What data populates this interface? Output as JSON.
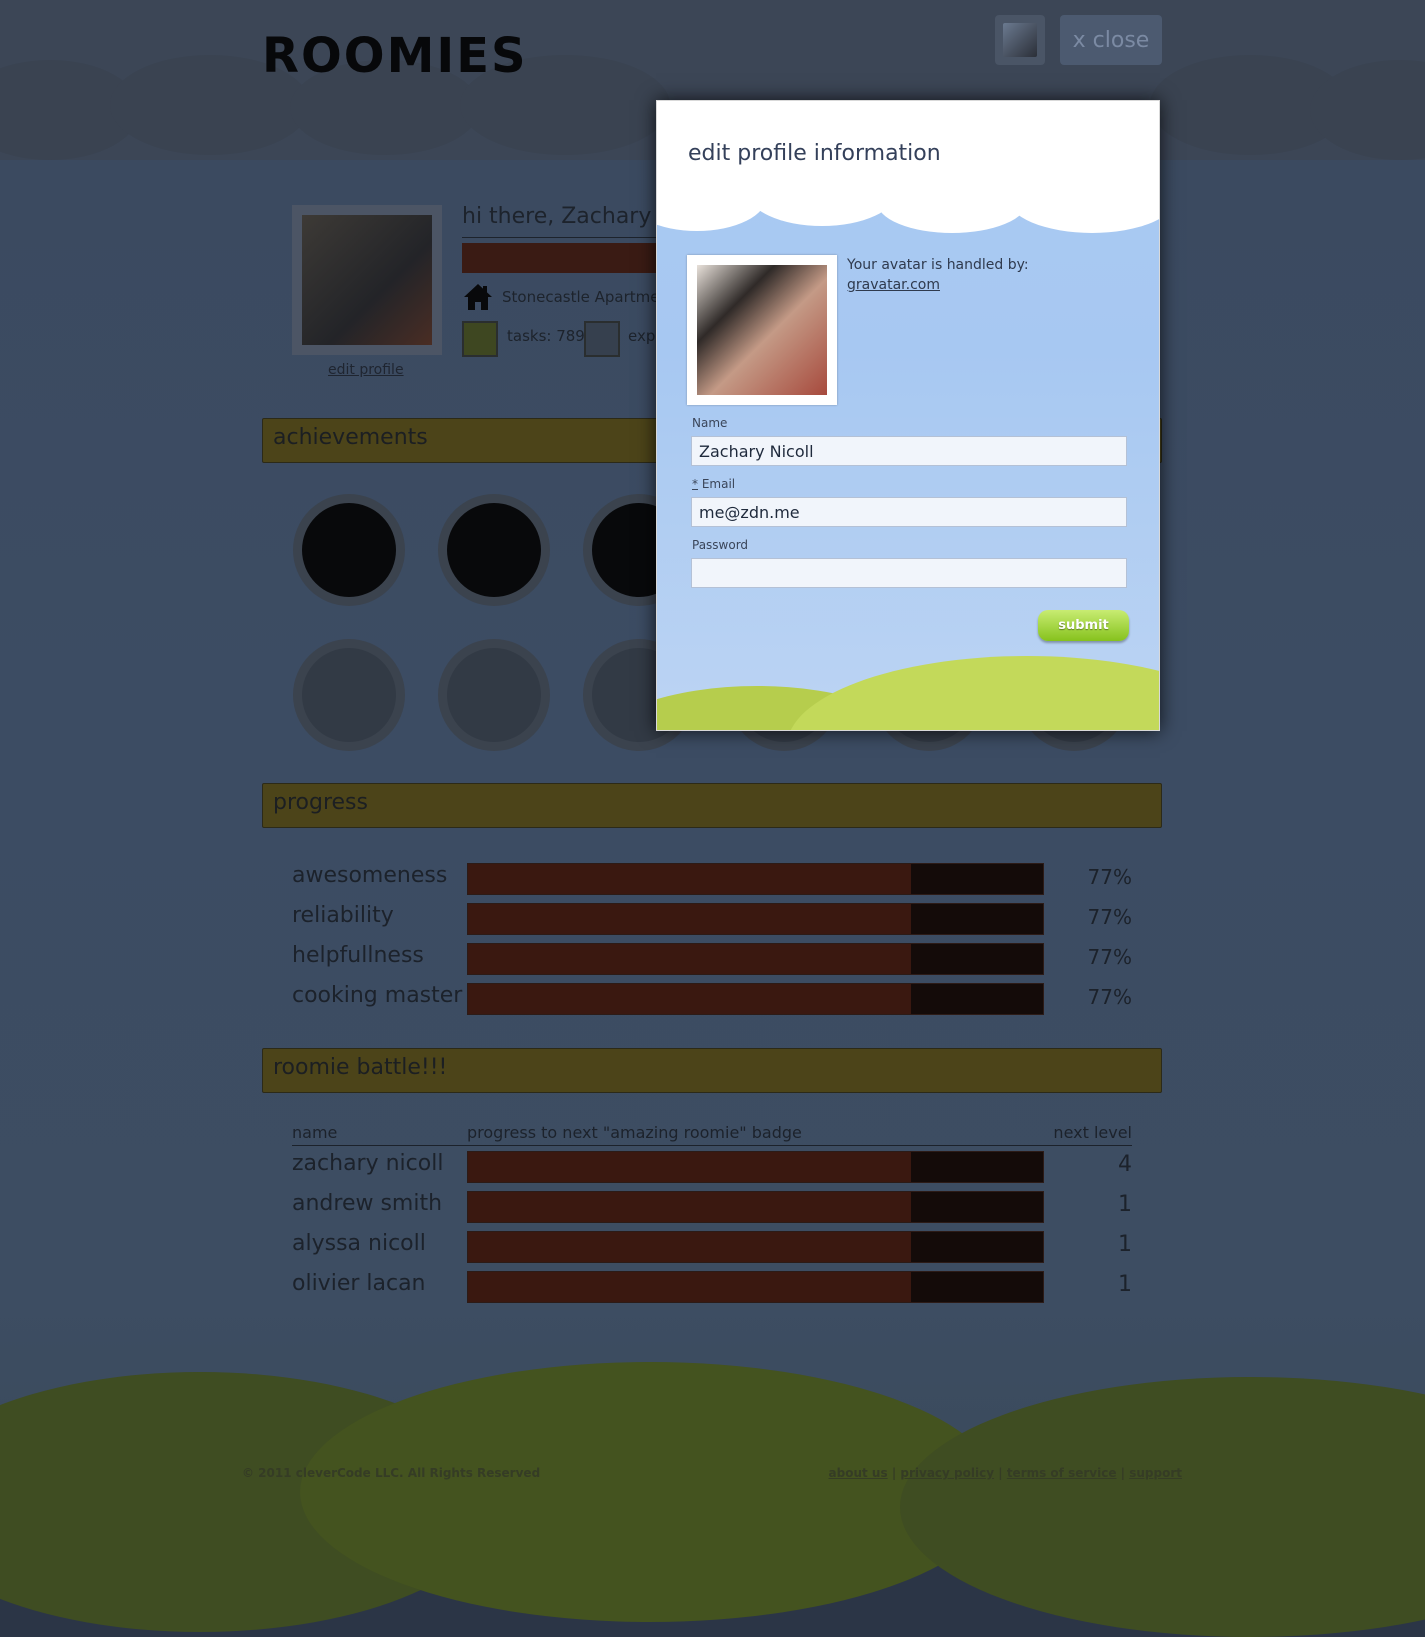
{
  "app": {
    "logo_text": "ROOMIES",
    "close_label": "x close"
  },
  "profile": {
    "greeting": "hi there, Zachary N",
    "apartment": "Stonecastle Apartmen",
    "tasks": "tasks: 789",
    "exp": "exp",
    "edit_profile": "edit profile"
  },
  "sections": {
    "achievements": "achievements",
    "progress": "progress",
    "battle": "roomie battle!!!"
  },
  "progress": [
    {
      "label": "awesomeness",
      "pct": "77%",
      "value": 0.77
    },
    {
      "label": "reliability",
      "pct": "77%",
      "value": 0.77
    },
    {
      "label": "helpfullness",
      "pct": "77%",
      "value": 0.77
    },
    {
      "label": "cooking master",
      "pct": "77%",
      "value": 0.77
    }
  ],
  "battle": {
    "headers": {
      "name": "name",
      "progress": "progress to next \"amazing roomie\" badge",
      "next": "next level"
    },
    "rows": [
      {
        "name": "zachary nicoll",
        "level": "4",
        "value": 0.77
      },
      {
        "name": "andrew smith",
        "level": "1",
        "value": 0.77
      },
      {
        "name": "alyssa nicoll",
        "level": "1",
        "value": 0.77
      },
      {
        "name": "olivier lacan",
        "level": "1",
        "value": 0.77
      }
    ]
  },
  "footer": {
    "copyright": "© 2011 cleverCode LLC. All Rights Reserved",
    "links": [
      "about us",
      "privacy policy",
      "terms of service",
      "support"
    ],
    "separator": "|"
  },
  "modal": {
    "title": "edit profile information",
    "avatar_text": "Your avatar is handled by:",
    "avatar_link": "gravatar.com",
    "name_label": "Name",
    "name_value": "Zachary Nicoll",
    "email_required": "*",
    "email_label": "Email",
    "email_value": "me@zdn.me",
    "password_label": "Password",
    "password_value": "",
    "submit_label": "submit"
  },
  "colors": {
    "accent_green": "#86c21d",
    "modal_sky": "#aacaf1",
    "section_bar": "#4c4419"
  }
}
